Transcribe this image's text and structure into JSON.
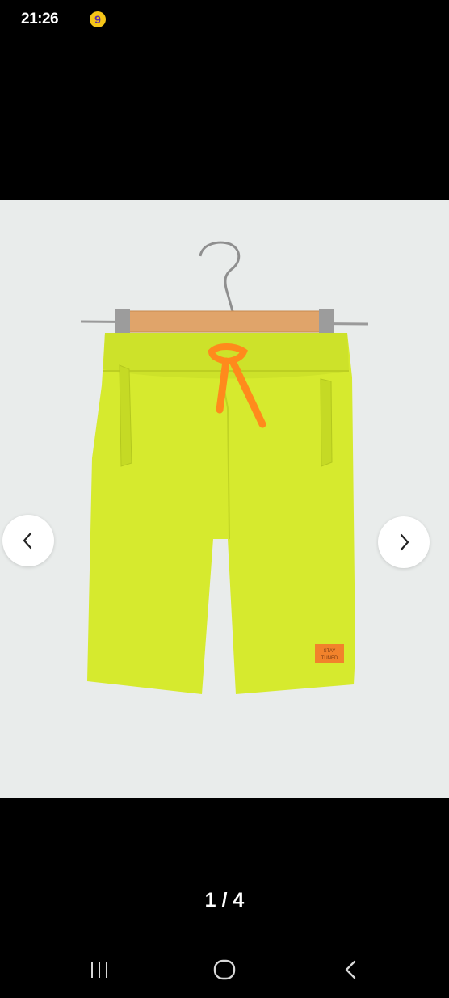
{
  "status_bar": {
    "time": "21:26",
    "app_icon": "app-notification-icon",
    "app_icon_glyph": "9"
  },
  "gallery": {
    "image": "product-image",
    "badge_text_line1": "STAY",
    "badge_text_line2": "TUNED",
    "prev_icon": "chevron-left-icon",
    "next_icon": "chevron-right-icon",
    "pager": "1 / 4",
    "colors": {
      "background": "#e9eceb",
      "shorts": "#d6ea2e",
      "drawstring": "#ff8a1c"
    }
  },
  "system_nav": {
    "recents_icon": "recents-icon",
    "home_icon": "home-icon",
    "back_icon": "back-icon"
  }
}
